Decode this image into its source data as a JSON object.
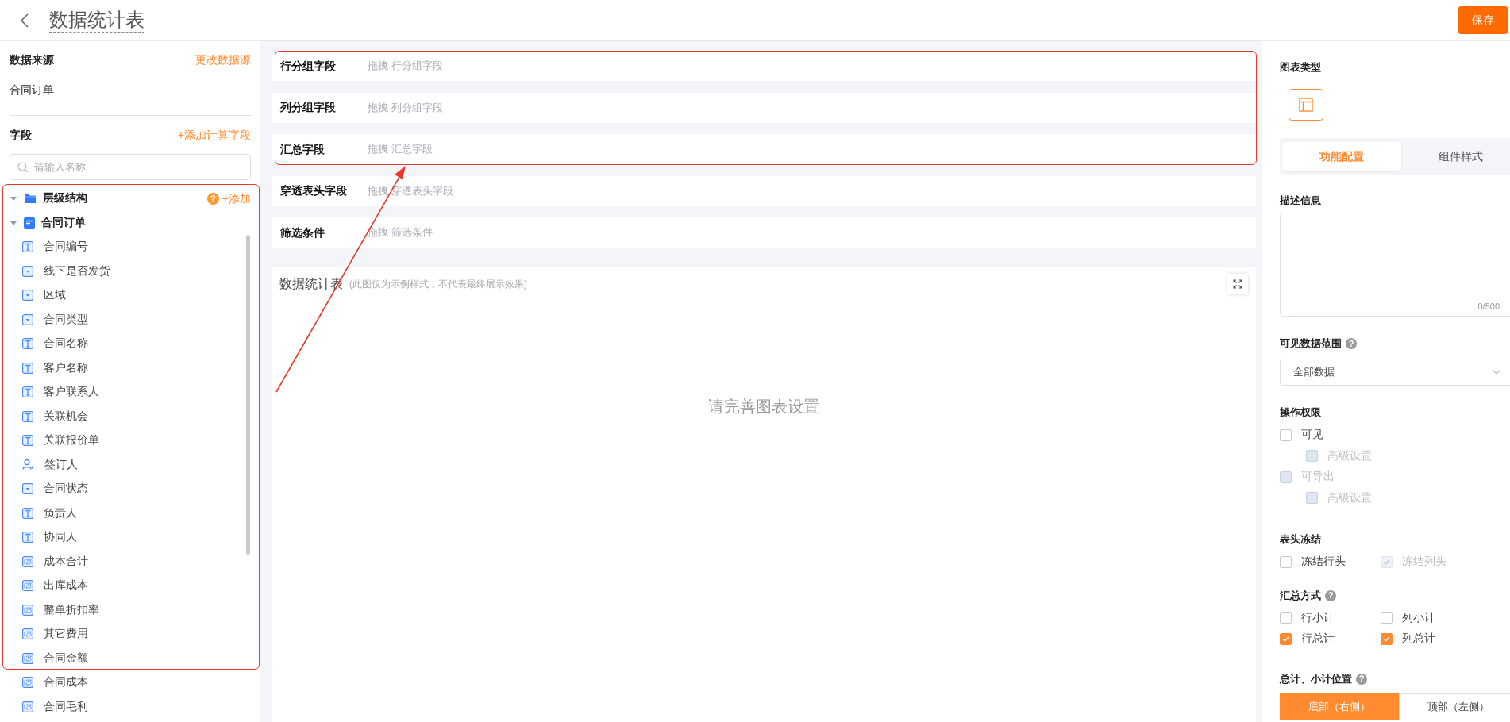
{
  "header": {
    "title": "数据统计表",
    "save_button": "保存"
  },
  "data_source": {
    "label": "数据来源",
    "action": "更改数据源",
    "name": "合同订单"
  },
  "fields": {
    "label": "字段",
    "action": "+添加计算字段",
    "search_placeholder": "请输入名称",
    "tree": [
      {
        "label": "层级结构",
        "kind": "folder",
        "expanded": true,
        "help": "?",
        "action": "+添加"
      },
      {
        "label": "合同订单",
        "kind": "form",
        "expanded": true,
        "children": [
          {
            "label": "合同编号",
            "kind": "text"
          },
          {
            "label": "线下是否发货",
            "kind": "select"
          },
          {
            "label": "区域",
            "kind": "select"
          },
          {
            "label": "合同类型",
            "kind": "select"
          },
          {
            "label": "合同名称",
            "kind": "text"
          },
          {
            "label": "客户名称",
            "kind": "text"
          },
          {
            "label": "客户联系人",
            "kind": "text"
          },
          {
            "label": "关联机会",
            "kind": "text"
          },
          {
            "label": "关联报价单",
            "kind": "text"
          },
          {
            "label": "签订人",
            "kind": "user"
          },
          {
            "label": "合同状态",
            "kind": "select"
          },
          {
            "label": "负责人",
            "kind": "text"
          },
          {
            "label": "协同人",
            "kind": "text"
          },
          {
            "label": "成本合计",
            "kind": "number"
          },
          {
            "label": "出库成本",
            "kind": "number"
          },
          {
            "label": "整单折扣率",
            "kind": "number"
          },
          {
            "label": "其它费用",
            "kind": "number"
          },
          {
            "label": "合同金额",
            "kind": "number"
          },
          {
            "label": "合同成本",
            "kind": "number"
          },
          {
            "label": "合同毛利",
            "kind": "number"
          }
        ]
      }
    ]
  },
  "drop_zones": [
    {
      "label": "行分组字段",
      "placeholder": "拖拽 行分组字段"
    },
    {
      "label": "列分组字段",
      "placeholder": "拖拽 列分组字段"
    },
    {
      "label": "汇总字段",
      "placeholder": "拖拽 汇总字段"
    },
    {
      "label": "穿透表头字段",
      "placeholder": "拖拽 穿透表头字段"
    },
    {
      "label": "筛选条件",
      "placeholder": "拖拽 筛选条件"
    }
  ],
  "preview": {
    "title": "数据统计表",
    "note": "(此图仅为示例样式，不代表最终展示效果)",
    "empty_text": "请完善图表设置"
  },
  "settings": {
    "chart_type": {
      "label": "图表类型",
      "types": [
        {
          "kind": "table",
          "selected": true
        }
      ]
    },
    "tabs": [
      {
        "label": "功能配置",
        "selected": true
      },
      {
        "label": "组件样式",
        "selected": false
      }
    ],
    "description": {
      "label": "描述信息",
      "counter": "0/500"
    },
    "visible_range": {
      "label": "可见数据范围",
      "help": "?",
      "value": "全部数据"
    },
    "permissions": {
      "label": "操作权限",
      "options": [
        {
          "label": "可见",
          "checked": false,
          "disabled": false,
          "children": [
            {
              "label": "高级设置",
              "checked": false,
              "disabled": true
            }
          ]
        },
        {
          "label": "可导出",
          "checked": false,
          "disabled": true,
          "children": [
            {
              "label": "高级设置",
              "checked": false,
              "disabled": true
            }
          ]
        }
      ]
    },
    "freeze": {
      "label": "表头冻结",
      "options": [
        {
          "label": "冻结行头",
          "checked": false,
          "disabled": false
        },
        {
          "label": "冻结列头",
          "checked": true,
          "disabled": true
        }
      ]
    },
    "summary": {
      "label": "汇总方式",
      "help": "?",
      "options": [
        {
          "label": "行小计",
          "checked": false,
          "disabled": false
        },
        {
          "label": "列小计",
          "checked": false,
          "disabled": false
        },
        {
          "label": "行总计",
          "checked": true,
          "disabled": false
        },
        {
          "label": "列总计",
          "checked": true,
          "disabled": false
        }
      ]
    },
    "position": {
      "label": "总计、小计位置",
      "help": "?",
      "options": [
        {
          "label": "底部（右侧）",
          "selected": true
        },
        {
          "label": "顶部（左侧）",
          "selected": false
        }
      ]
    }
  }
}
